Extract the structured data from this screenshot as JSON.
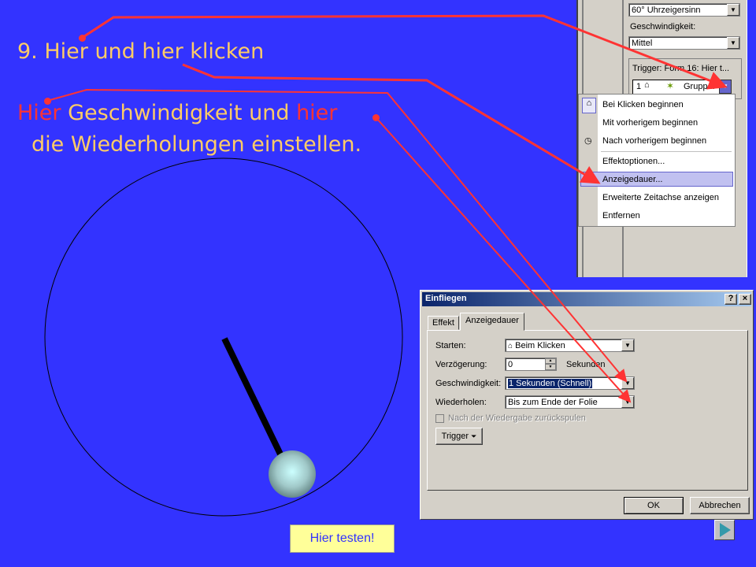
{
  "slide": {
    "step_text": "9. Hier und hier klicken",
    "line2_a": "Hier",
    "line2_b": " Geschwindigkeit und ",
    "line2_c": "hier",
    "line3": "die Wiederholungen einstellen.",
    "test_button": "Hier testen!"
  },
  "effects_pane": {
    "direction_value": "60° Uhrzeigersinn",
    "speed_label": "Geschwindigkeit:",
    "speed_value": "Mittel",
    "trigger_header": "Trigger: Form 16: Hier t...",
    "item_number": "1",
    "item_label": "Grupp..."
  },
  "context_menu": {
    "items": [
      "Bei Klicken beginnen",
      "Mit vorherigem beginnen",
      "Nach vorherigem beginnen",
      "Effektoptionen...",
      "Anzeigedauer...",
      "Erweiterte Zeitachse anzeigen",
      "Entfernen"
    ]
  },
  "dialog": {
    "title": "Einfliegen",
    "help_button": "?",
    "close_button": "×",
    "tabs": [
      "Effekt",
      "Anzeigedauer"
    ],
    "start_label": "Starten:",
    "start_value": "Beim Klicken",
    "delay_label": "Verzögerung:",
    "delay_value": "0",
    "delay_unit": "Sekunden",
    "speed_label": "Geschwindigkeit:",
    "speed_value": "1 Sekunden (Schnell)",
    "repeat_label": "Wiederholen:",
    "repeat_value": "Bis zum Ende der Folie",
    "rewind_label": "Nach der Wiedergabe zurückspulen",
    "trigger_button": "Trigger",
    "ok_button": "OK",
    "cancel_button": "Abbrechen"
  },
  "colors": {
    "background": "#3333ff",
    "highlight_text": "#ffcc66",
    "accent": "#ff3333"
  }
}
